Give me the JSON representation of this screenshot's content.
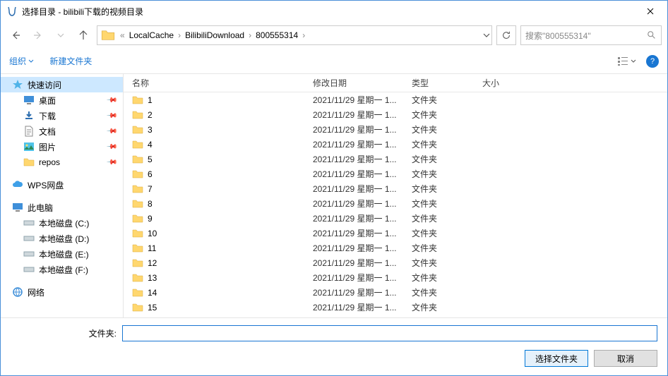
{
  "window": {
    "title": "选择目录 - bilibili下载的视频目录"
  },
  "breadcrumb": {
    "prefix": "«",
    "items": [
      "LocalCache",
      "BilibiliDownload",
      "800555314"
    ]
  },
  "search": {
    "placeholder": "搜索\"800555314\""
  },
  "toolbar": {
    "organize": "组织",
    "newfolder": "新建文件夹"
  },
  "columns": {
    "name": "名称",
    "date": "修改日期",
    "type": "类型",
    "size": "大小"
  },
  "sidebar": {
    "quick": "快速访问",
    "desktop": "桌面",
    "downloads": "下载",
    "documents": "文档",
    "pictures": "图片",
    "repos": "repos",
    "wps": "WPS网盘",
    "thispc": "此电脑",
    "driveC": "本地磁盘 (C:)",
    "driveD": "本地磁盘 (D:)",
    "driveE": "本地磁盘 (E:)",
    "driveF": "本地磁盘 (F:)",
    "network": "网络"
  },
  "files": [
    {
      "name": "1",
      "date": "2021/11/29 星期一 1...",
      "type": "文件夹"
    },
    {
      "name": "2",
      "date": "2021/11/29 星期一 1...",
      "type": "文件夹"
    },
    {
      "name": "3",
      "date": "2021/11/29 星期一 1...",
      "type": "文件夹"
    },
    {
      "name": "4",
      "date": "2021/11/29 星期一 1...",
      "type": "文件夹"
    },
    {
      "name": "5",
      "date": "2021/11/29 星期一 1...",
      "type": "文件夹"
    },
    {
      "name": "6",
      "date": "2021/11/29 星期一 1...",
      "type": "文件夹"
    },
    {
      "name": "7",
      "date": "2021/11/29 星期一 1...",
      "type": "文件夹"
    },
    {
      "name": "8",
      "date": "2021/11/29 星期一 1...",
      "type": "文件夹"
    },
    {
      "name": "9",
      "date": "2021/11/29 星期一 1...",
      "type": "文件夹"
    },
    {
      "name": "10",
      "date": "2021/11/29 星期一 1...",
      "type": "文件夹"
    },
    {
      "name": "11",
      "date": "2021/11/29 星期一 1...",
      "type": "文件夹"
    },
    {
      "name": "12",
      "date": "2021/11/29 星期一 1...",
      "type": "文件夹"
    },
    {
      "name": "13",
      "date": "2021/11/29 星期一 1...",
      "type": "文件夹"
    },
    {
      "name": "14",
      "date": "2021/11/29 星期一 1...",
      "type": "文件夹"
    },
    {
      "name": "15",
      "date": "2021/11/29 星期一 1...",
      "type": "文件夹"
    }
  ],
  "footer": {
    "label": "文件夹:",
    "select": "选择文件夹",
    "cancel": "取消"
  }
}
